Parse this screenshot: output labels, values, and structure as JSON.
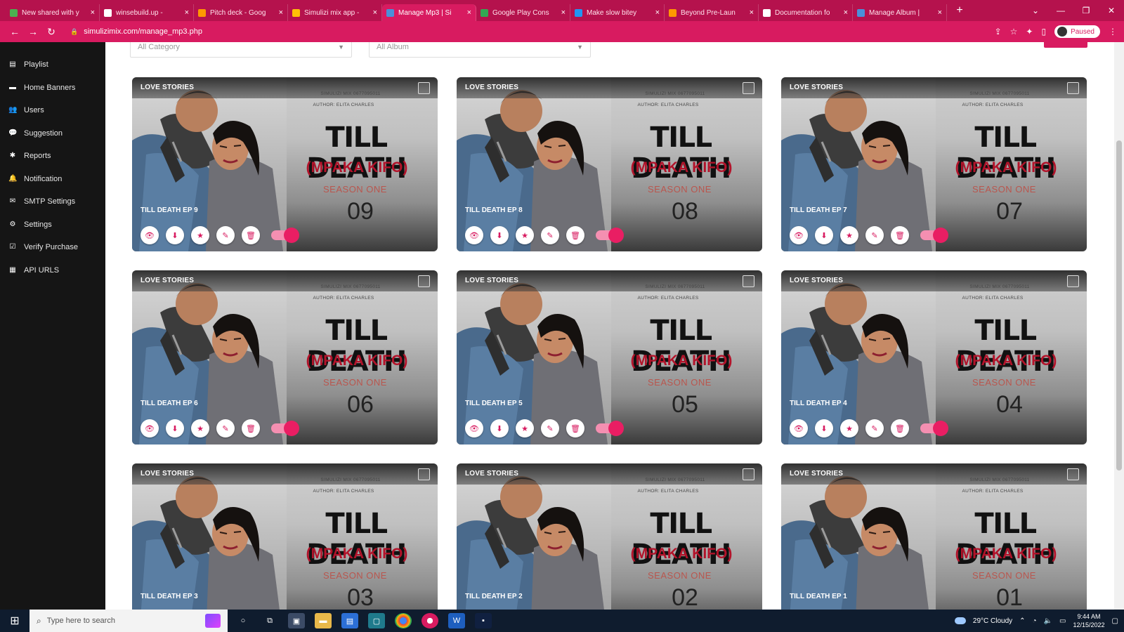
{
  "browser": {
    "tabs": [
      {
        "label": "New shared with y",
        "color": "#4caf50",
        "active": false
      },
      {
        "label": "winsebuild.up -",
        "color": "#ffffff",
        "active": false
      },
      {
        "label": "Pitch deck - Goog",
        "color": "#ff9800",
        "active": false
      },
      {
        "label": "Simulizi mix app -",
        "color": "#ffc107",
        "active": false
      },
      {
        "label": "Manage Mp3 | Si",
        "color": "#4a90d9",
        "active": true
      },
      {
        "label": "Google Play Cons",
        "color": "#34a853",
        "active": false
      },
      {
        "label": "Make slow bitey",
        "color": "#2196f3",
        "active": false
      },
      {
        "label": "Beyond Pre-Laun",
        "color": "#ff9800",
        "active": false
      },
      {
        "label": "Documentation fo",
        "color": "#ffffff",
        "active": false
      },
      {
        "label": "Manage Album |",
        "color": "#4a90d9",
        "active": false
      }
    ],
    "tab_close": "×",
    "new_tab": "+",
    "url": "simulizimix.com/manage_mp3.php",
    "profile_label": "Paused"
  },
  "sidebar": {
    "items": [
      {
        "label": "Playlist",
        "icon": "playlist-icon",
        "glyph": "▤"
      },
      {
        "label": "Home Banners",
        "icon": "banner-icon",
        "glyph": "▬"
      },
      {
        "label": "Users",
        "icon": "users-icon",
        "glyph": "👥"
      },
      {
        "label": "Suggestion",
        "icon": "suggestion-icon",
        "glyph": "💬"
      },
      {
        "label": "Reports",
        "icon": "reports-icon",
        "glyph": "✱"
      },
      {
        "label": "Notification",
        "icon": "bell-icon",
        "glyph": "🔔"
      },
      {
        "label": "SMTP Settings",
        "icon": "mail-icon",
        "glyph": "✉"
      },
      {
        "label": "Settings",
        "icon": "gear-icon",
        "glyph": "⚙"
      },
      {
        "label": "Verify Purchase",
        "icon": "check-icon",
        "glyph": "☑"
      },
      {
        "label": "API URLS",
        "icon": "api-icon",
        "glyph": "▦"
      }
    ]
  },
  "filters": {
    "category_value": "All Category",
    "album_value": "All Album"
  },
  "cards": [
    {
      "category": "LOVE STORIES",
      "episode_label": "TILL DEATH EP 9",
      "number": "09"
    },
    {
      "category": "LOVE STORIES",
      "episode_label": "TILL DEATH EP 8",
      "number": "08"
    },
    {
      "category": "LOVE STORIES",
      "episode_label": "TILL DEATH EP 7",
      "number": "07"
    },
    {
      "category": "LOVE STORIES",
      "episode_label": "TILL DEATH EP 6",
      "number": "06"
    },
    {
      "category": "LOVE STORIES",
      "episode_label": "TILL DEATH EP 5",
      "number": "05"
    },
    {
      "category": "LOVE STORIES",
      "episode_label": "TILL DEATH EP 4",
      "number": "04"
    },
    {
      "category": "LOVE STORIES",
      "episode_label": "TILL DEATH EP 3",
      "number": "03"
    },
    {
      "category": "LOVE STORIES",
      "episode_label": "TILL DEATH EP 2",
      "number": "02"
    },
    {
      "category": "LOVE STORIES",
      "episode_label": "TILL DEATH EP 1",
      "number": "01"
    }
  ],
  "poster": {
    "title": "TILL DEATH",
    "subtitle": "(MPAKA KIFO)",
    "season": "SEASON ONE",
    "credit_line1": "SIMULIZI MIX 0677095011",
    "credit_line2": "AUTHOR: ELITA CHARLES"
  },
  "card_actions": [
    {
      "name": "view-icon",
      "glyph": "👁"
    },
    {
      "name": "download-icon",
      "glyph": "⬇"
    },
    {
      "name": "star-icon",
      "glyph": "★"
    },
    {
      "name": "edit-icon",
      "glyph": "✎"
    },
    {
      "name": "delete-icon",
      "glyph": "🗑"
    }
  ],
  "taskbar": {
    "search_placeholder": "Type here to search",
    "weather": "29°C  Cloudy",
    "time": "9:44 AM",
    "date": "12/15/2022"
  },
  "colors": {
    "accent": "#d81b60",
    "sidebar_bg": "#151515",
    "toggle_on": "#e91e63"
  }
}
